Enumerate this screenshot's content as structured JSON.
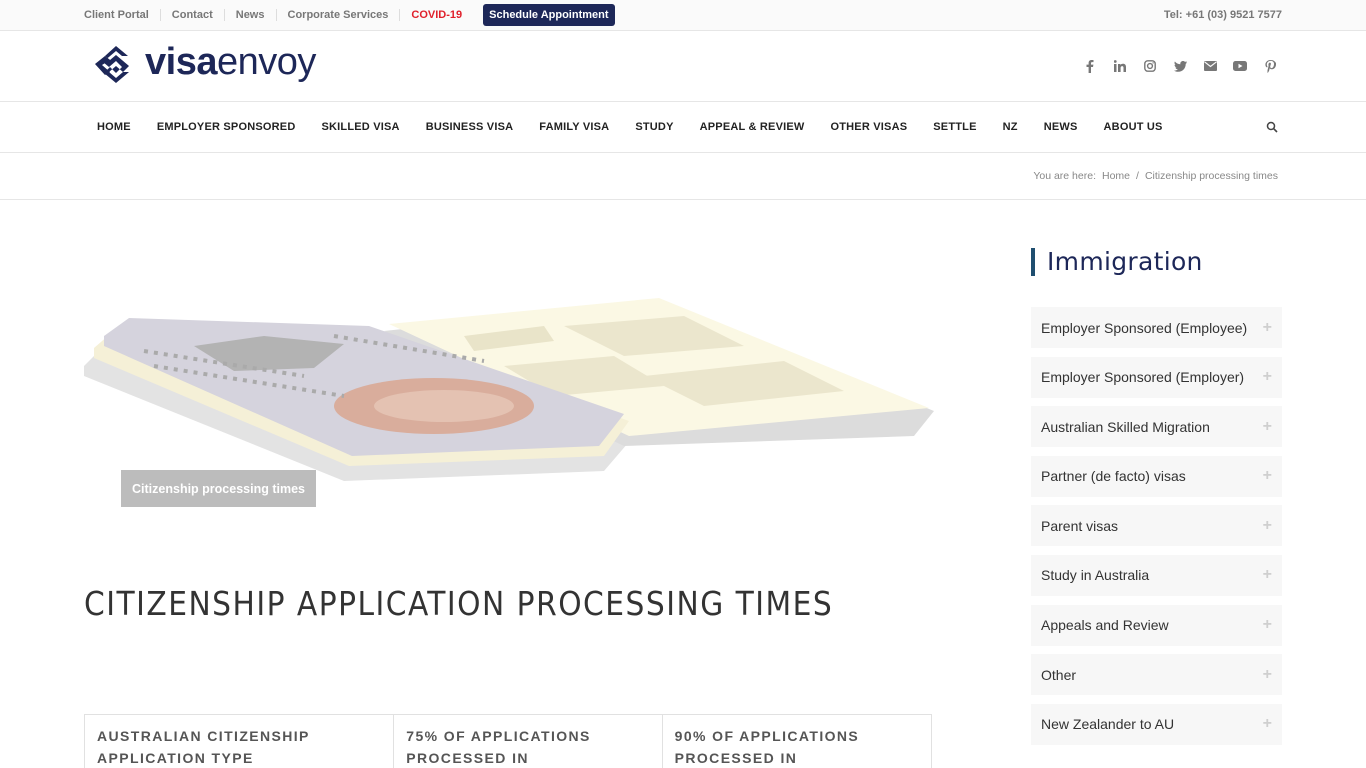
{
  "topbar": {
    "links": [
      "Client Portal",
      "Contact",
      "News",
      "Corporate Services",
      "COVID-19"
    ],
    "schedule_button": "Schedule Appointment",
    "phone": "Tel: +61 (03) 9521 7577"
  },
  "brand": {
    "part1": "visa",
    "part2": "envoy"
  },
  "social": {
    "icons": [
      "facebook-icon",
      "linkedin-icon",
      "instagram-icon",
      "twitter-icon",
      "mail-icon",
      "youtube-icon",
      "pinterest-icon"
    ]
  },
  "nav": {
    "items": [
      "HOME",
      "EMPLOYER SPONSORED",
      "SKILLED VISA",
      "BUSINESS VISA",
      "FAMILY VISA",
      "STUDY",
      "APPEAL & REVIEW",
      "OTHER VISAS",
      "SETTLE",
      "NZ",
      "NEWS",
      "ABOUT US"
    ]
  },
  "breadcrumb": {
    "prefix": "You are here:",
    "home": "Home",
    "separator": "/",
    "current": "Citizenship processing times"
  },
  "hero": {
    "caption": "Citizenship processing times"
  },
  "page": {
    "title": "CITIZENSHIP APPLICATION PROCESSING TIMES"
  },
  "table": {
    "headers": [
      "AUSTRALIAN CITIZENSHIP APPLICATION TYPE",
      "75% OF APPLICATIONS PROCESSED IN",
      "90% OF APPLICATIONS PROCESSED IN"
    ]
  },
  "sidebar": {
    "title": "Immigration",
    "items": [
      "Employer Sponsored (Employee)",
      "Employer Sponsored (Employer)",
      "Australian Skilled Migration",
      "Partner (de facto) visas",
      "Parent visas",
      "Study in Australia",
      "Appeals and Review",
      "Other",
      "New Zealander to AU"
    ],
    "expand_symbol": "+"
  },
  "colors": {
    "brand_navy": "#1d2758",
    "covid_red": "#e0202b",
    "sidebar_accent": "#1f4e6f"
  }
}
